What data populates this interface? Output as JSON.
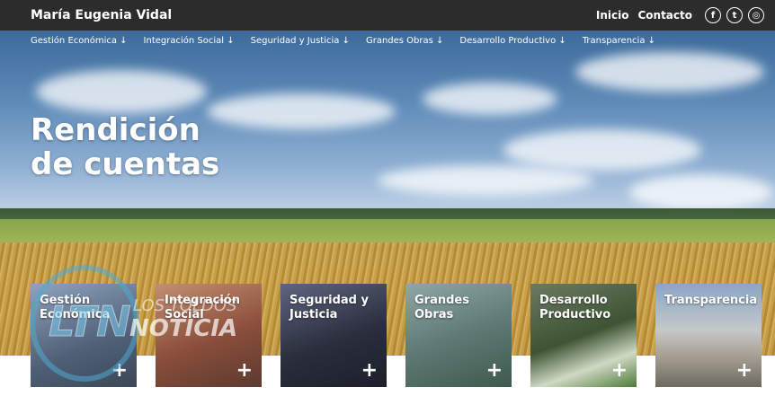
{
  "header": {
    "brand": "María Eugenia Vidal",
    "nav": [
      "Inicio",
      "Contacto"
    ],
    "social": [
      {
        "icon": "facebook-icon",
        "glyph": "f"
      },
      {
        "icon": "twitter-icon",
        "glyph": "t"
      },
      {
        "icon": "instagram-icon",
        "glyph": "◎"
      }
    ]
  },
  "subnav": [
    "Gestión Económica ↓",
    "Integración Social ↓",
    "Seguridad y Justicia ↓",
    "Grandes Obras ↓",
    "Desarrollo Productivo ↓",
    "Transparencia ↓"
  ],
  "hero": {
    "title_line1": "Rendición",
    "title_line2": "de cuentas"
  },
  "watermark": {
    "logo": "LTN",
    "text": "LOS TOLDOS NOTICIA"
  },
  "cards": [
    {
      "line1": "Gestión",
      "line2": "Económica",
      "plus": "+",
      "color": "#5a6f8a"
    },
    {
      "line1": "Integración",
      "line2": "Social",
      "plus": "+",
      "color": "#9a6a55"
    },
    {
      "line1": "Seguridad y",
      "line2": "Justicia",
      "plus": "+",
      "color": "#34384a"
    },
    {
      "line1": "Grandes",
      "line2": "Obras",
      "plus": "+",
      "color": "#6f8c8a"
    },
    {
      "line1": "Desarrollo",
      "line2": "Productivo",
      "plus": "+",
      "color": "#4d6b3f"
    },
    {
      "line1": "Transparencia",
      "line2": "",
      "plus": "+",
      "color": "#7e8fa3"
    }
  ]
}
